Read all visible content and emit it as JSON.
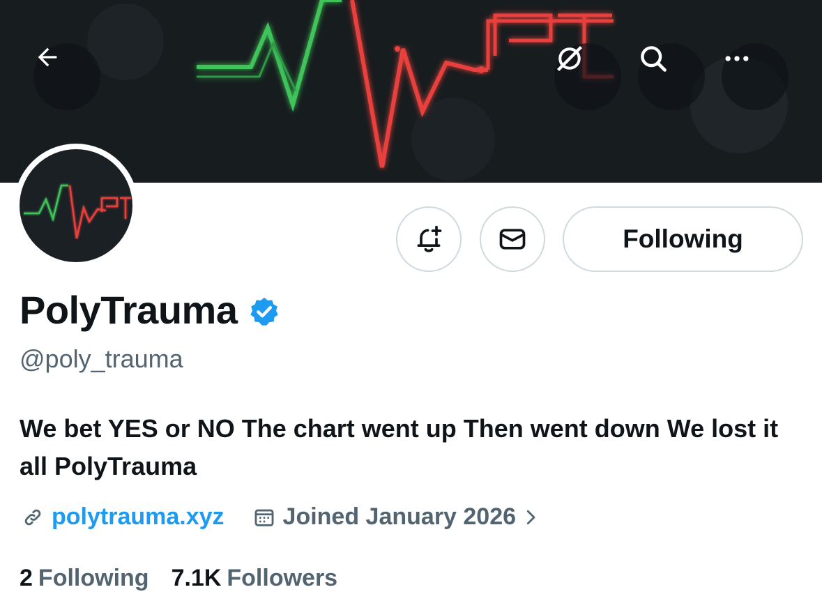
{
  "banner": {
    "colors": {
      "background": "#171c1e",
      "green_line": "#3fc45a",
      "red_line": "#e8413c"
    }
  },
  "header_buttons": {
    "back_icon": "arrow-left-icon",
    "grok_icon": "grok-icon",
    "search_icon": "search-icon",
    "more_icon": "more-dots-icon"
  },
  "actions": {
    "notify_icon": "bell-plus-icon",
    "message_icon": "envelope-icon",
    "following_label": "Following"
  },
  "profile": {
    "display_name": "PolyTrauma",
    "handle": "@poly_trauma",
    "bio": "We bet YES or NO The chart went up Then went down We lost it all PolyTrauma",
    "website": "polytrauma.xyz",
    "joined": "Joined January 2026",
    "accent_color": "#1d9bf0"
  },
  "stats": {
    "following_count": "2",
    "following_label": "Following",
    "followers_count": "7.1K",
    "followers_label": "Followers"
  }
}
